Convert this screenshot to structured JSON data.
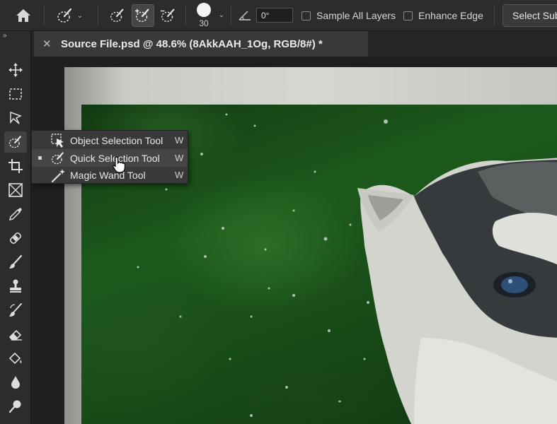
{
  "options_bar": {
    "brush_size": "30",
    "angle_value": "0°",
    "sample_all_layers_label": "Sample All Layers",
    "sample_all_layers_checked": false,
    "enhance_edge_label": "Enhance Edge",
    "enhance_edge_checked": false,
    "select_subject_label": "Select Subject"
  },
  "tabs": [
    {
      "title": "Source File.psd @ 48.6% (8AkkAAH_1Og, RGB/8#) *"
    }
  ],
  "flyout": {
    "items": [
      {
        "label": "Object Selection Tool",
        "shortcut": "W",
        "selected": false,
        "icon": "object-selection-icon"
      },
      {
        "label": "Quick Selection Tool",
        "shortcut": "W",
        "selected": true,
        "icon": "quick-selection-icon"
      },
      {
        "label": "Magic Wand Tool",
        "shortcut": "W",
        "selected": false,
        "icon": "magic-wand-icon"
      }
    ]
  },
  "tools": [
    "move-icon",
    "marquee-icon",
    "lasso-icon",
    "quick-selection-icon",
    "crop-icon",
    "frame-icon",
    "eyedropper-icon",
    "healing-brush-icon",
    "brush-icon",
    "clone-stamp-icon",
    "history-brush-icon",
    "eraser-icon",
    "paint-bucket-icon",
    "blur-icon",
    "dodge-icon"
  ],
  "colors": {
    "panel_bg": "#2c2c2c",
    "flyout_bg": "#393939",
    "active_highlight": "#454545"
  }
}
